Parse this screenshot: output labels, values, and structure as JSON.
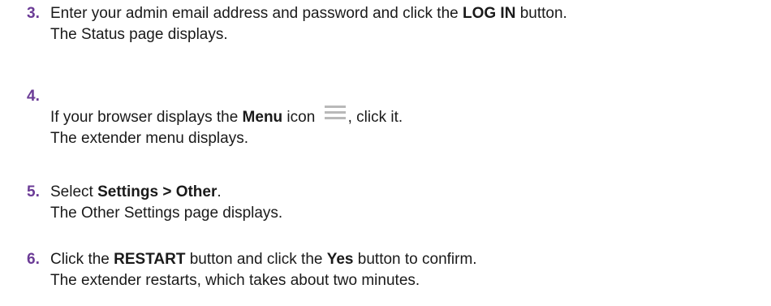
{
  "colors": {
    "step_number": "#6b3b96",
    "text": "#1a1a1a",
    "menu_icon": "#b9b9b9"
  },
  "steps": [
    {
      "number": "3.",
      "line1": {
        "pre": "Enter your admin email address and password and click the ",
        "bold": "LOG IN",
        "post": " button."
      },
      "line2": "The Status page displays."
    },
    {
      "number": "4.",
      "line1": {
        "pre": "If your browser displays the ",
        "bold": "Menu",
        "mid": " icon ",
        "icon": "hamburger-menu-icon",
        "post": ", click it."
      },
      "line2": "The extender menu displays."
    },
    {
      "number": "5.",
      "line1": {
        "pre": "Select ",
        "bold": "Settings > Other",
        "post": "."
      },
      "line2": "The Other Settings page displays."
    },
    {
      "number": "6.",
      "line1": {
        "pre": "Click the ",
        "bold": "RESTART",
        "mid": " button and click the ",
        "bold2": "Yes",
        "post": " button to confirm."
      },
      "line2": "The extender restarts, which takes about two minutes."
    }
  ]
}
